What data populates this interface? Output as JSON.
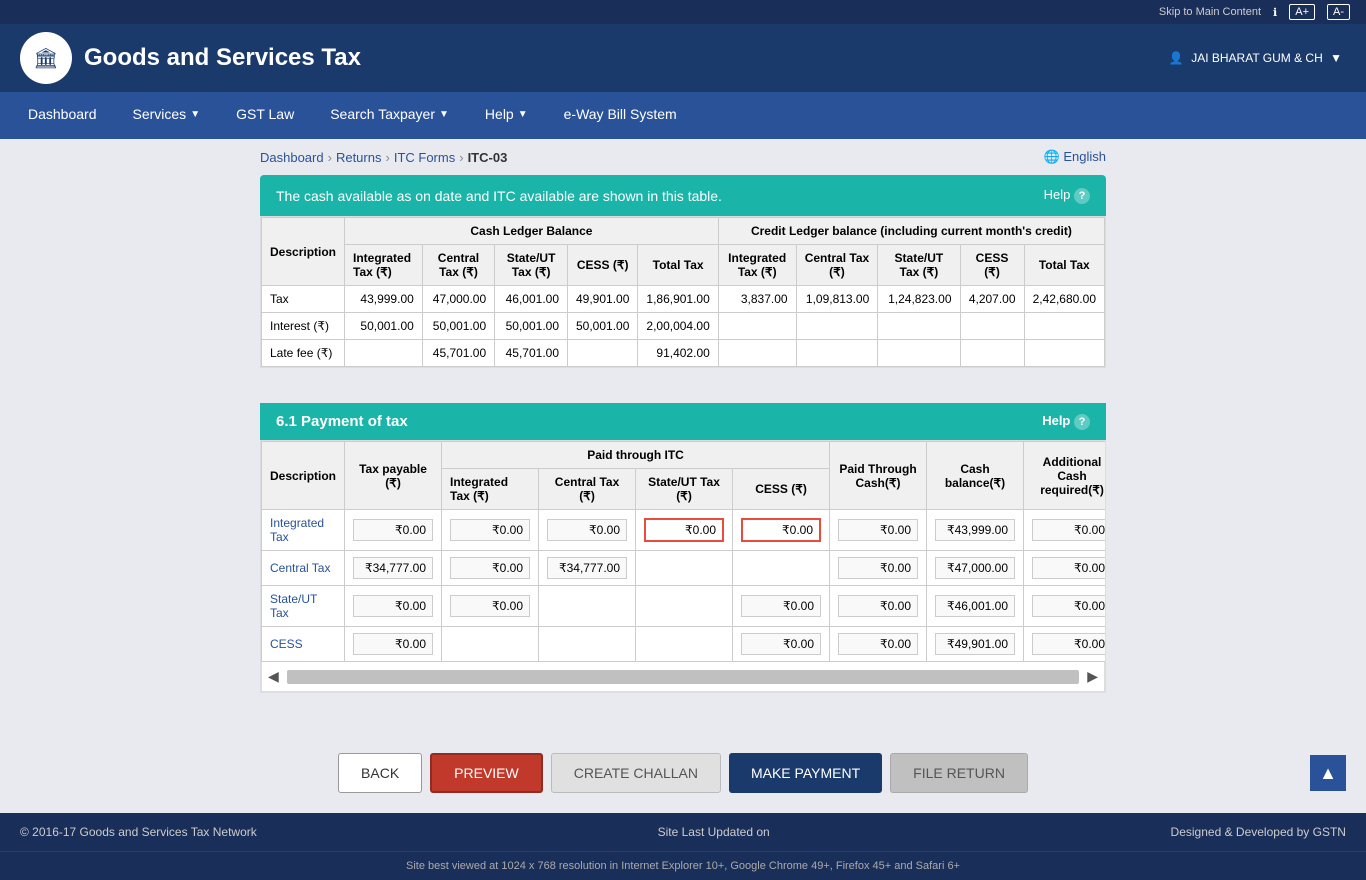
{
  "topbar": {
    "skip_link": "Skip to Main Content",
    "info_icon": "ℹ",
    "font_large": "A+",
    "font_small": "A-"
  },
  "header": {
    "logo_text": "🏛",
    "title": "Goods and Services Tax",
    "user": "JAI BHARAT GUM & CH",
    "user_icon": "👤"
  },
  "nav": {
    "items": [
      {
        "label": "Dashboard",
        "has_dropdown": false
      },
      {
        "label": "Services",
        "has_dropdown": true
      },
      {
        "label": "GST Law",
        "has_dropdown": false
      },
      {
        "label": "Search Taxpayer",
        "has_dropdown": true
      },
      {
        "label": "Help",
        "has_dropdown": true
      },
      {
        "label": "e-Way Bill System",
        "has_dropdown": false
      }
    ]
  },
  "breadcrumb": {
    "items": [
      "Dashboard",
      "Returns",
      "ITC Forms",
      "ITC-03"
    ],
    "language": "🌐 English"
  },
  "info_section": {
    "message": "The cash available as on date and ITC available are shown in this table.",
    "help_label": "Help ?"
  },
  "cash_table": {
    "headers": {
      "col1": "Description",
      "group1": "Cash Ledger Balance",
      "group2": "Credit Ledger balance (including current month's credit)"
    },
    "sub_headers": [
      "Integrated Tax (₹)",
      "Central Tax (₹)",
      "State/UT Tax (₹)",
      "CESS (₹)",
      "Total Tax",
      "Integrated Tax (₹)",
      "Central Tax (₹)",
      "State/UT Tax (₹)",
      "CESS (₹)",
      "Total Tax"
    ],
    "rows": [
      {
        "description": "Tax",
        "int_tax": "43,999.00",
        "central_tax": "47,000.00",
        "state_ut_tax": "46,001.00",
        "cess": "49,901.00",
        "total_tax": "1,86,901.00",
        "credit_int": "3,837.00",
        "credit_central": "1,09,813.00",
        "credit_state": "1,24,823.00",
        "credit_cess": "4,207.00",
        "credit_total": "2,42,680.00"
      },
      {
        "description": "Interest (₹)",
        "int_tax": "50,001.00",
        "central_tax": "50,001.00",
        "state_ut_tax": "50,001.00",
        "cess": "50,001.00",
        "total_tax": "2,00,004.00",
        "credit_int": "",
        "credit_central": "",
        "credit_state": "",
        "credit_cess": "",
        "credit_total": ""
      },
      {
        "description": "Late fee (₹)",
        "int_tax": "",
        "central_tax": "45,701.00",
        "state_ut_tax": "45,701.00",
        "cess": "",
        "total_tax": "91,402.00",
        "credit_int": "",
        "credit_central": "",
        "credit_state": "",
        "credit_cess": "",
        "credit_total": ""
      }
    ]
  },
  "payment_section": {
    "title": "6.1 Payment of tax",
    "help_label": "Help ?",
    "headers": {
      "description": "Description",
      "tax_payable": "Tax payable (₹)",
      "paid_through_itc": "Paid through ITC",
      "itc_int": "Integrated Tax (₹)",
      "itc_central": "Central Tax (₹)",
      "itc_state": "State/UT Tax (₹)",
      "itc_cess": "CESS (₹)",
      "paid_through_cash": "Paid Through Cash(₹)",
      "cash_balance": "Cash balance(₹)",
      "additional_cash": "Additional Cash required(₹)"
    },
    "rows": [
      {
        "description": "Integrated Tax",
        "tax_payable": "₹0.00",
        "itc_int": "₹0.00",
        "itc_central": "₹0.00",
        "itc_state": "₹0.00",
        "itc_cess": "₹0.00",
        "itc_state_highlighted": true,
        "itc_cess_highlighted": true,
        "paid_cash": "₹0.00",
        "cash_balance": "₹43,999.00",
        "additional": "₹0.00"
      },
      {
        "description": "Central Tax",
        "tax_payable": "₹34,777.00",
        "itc_int": "₹0.00",
        "itc_central": "₹34,777.00",
        "itc_state": "",
        "itc_cess": "",
        "paid_cash": "₹0.00",
        "cash_balance": "₹47,000.00",
        "additional": "₹0.00"
      },
      {
        "description": "State/UT Tax",
        "tax_payable": "₹0.00",
        "itc_int": "₹0.00",
        "itc_central": "",
        "itc_state": "",
        "itc_cess": "₹0.00",
        "paid_cash": "₹0.00",
        "cash_balance": "₹46,001.00",
        "additional": "₹0.00"
      },
      {
        "description": "CESS",
        "tax_payable": "₹0.00",
        "itc_int": "",
        "itc_central": "",
        "itc_state": "",
        "itc_cess": "₹0.00",
        "paid_cash": "₹0.00",
        "cash_balance": "₹49,901.00",
        "additional": "₹0.00"
      }
    ]
  },
  "buttons": {
    "back": "BACK",
    "preview": "PREVIEW",
    "create_challan": "CREATE CHALLAN",
    "make_payment": "MAKE PAYMENT",
    "file_return": "FILE RETURN"
  },
  "footer": {
    "copyright": "© 2016-17 Goods and Services Tax Network",
    "last_updated": "Site Last Updated on",
    "designed_by": "Designed & Developed by GSTN",
    "browser_note": "Site best viewed at 1024 x 768 resolution in Internet Explorer 10+, Google Chrome 49+, Firefox 45+ and Safari 6+"
  }
}
